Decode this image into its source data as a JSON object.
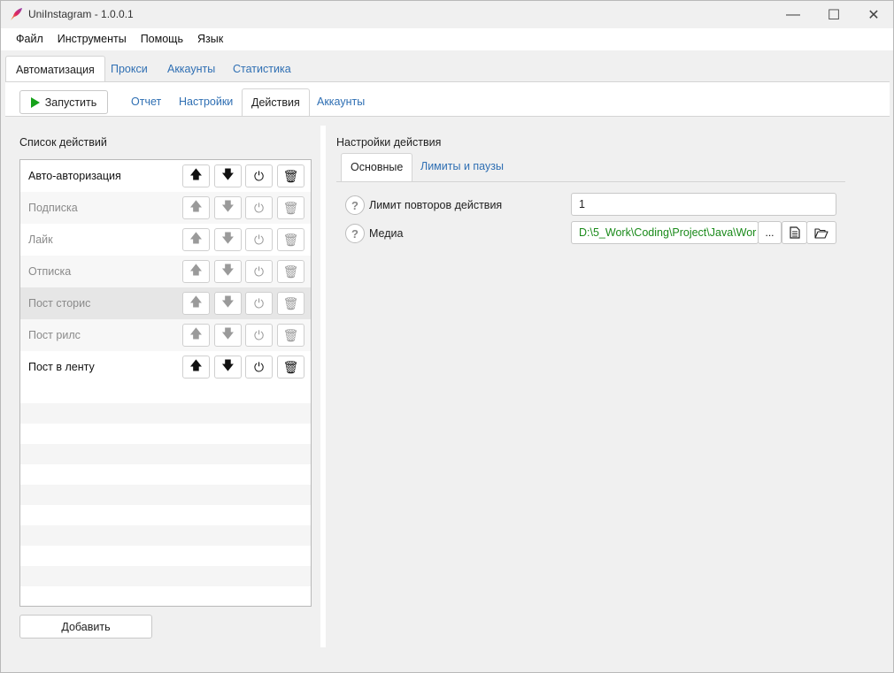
{
  "window": {
    "title": "UniInstagram - 1.0.0.1",
    "controls": {
      "minimize": "—",
      "maximize": "☐",
      "close": "✕"
    }
  },
  "menu": [
    "Файл",
    "Инструменты",
    "Помощь",
    "Язык"
  ],
  "main_tabs": [
    "Автоматизация",
    "Прокси",
    "Аккаунты",
    "Статистика"
  ],
  "toolbar": {
    "run_label": "Запустить"
  },
  "sub_tabs": [
    "Отчет",
    "Настройки",
    "Действия",
    "Аккаунты"
  ],
  "actions_panel": {
    "title": "Список действий",
    "items": [
      {
        "label": "Авто-авторизация",
        "enabled": true,
        "highlighted": false
      },
      {
        "label": "Подписка",
        "enabled": false,
        "highlighted": false
      },
      {
        "label": "Лайк",
        "enabled": false,
        "highlighted": false
      },
      {
        "label": "Отписка",
        "enabled": false,
        "highlighted": false
      },
      {
        "label": "Пост сторис",
        "enabled": false,
        "highlighted": true
      },
      {
        "label": "Пост рилс",
        "enabled": false,
        "highlighted": false
      },
      {
        "label": "Пост в ленту",
        "enabled": true,
        "highlighted": false
      }
    ],
    "add_label": "Добавить"
  },
  "settings_panel": {
    "title": "Настройки действия",
    "tabs": [
      "Основные",
      "Лимиты и паузы"
    ],
    "fields": {
      "repeat_limit": {
        "label": "Лимит повторов действия",
        "value": "1"
      },
      "media": {
        "label": "Медиа",
        "value": "D:\\5_Work\\Coding\\Project\\Java\\Wor",
        "browse_label": "..."
      }
    }
  },
  "icons": {
    "help": "?",
    "up": "🡅",
    "down": "🡇",
    "power": "⏻",
    "trash": "🗑"
  },
  "colors": {
    "accent_link": "#2f6fb3",
    "play": "#16a21a",
    "path_text": "#1a8a1a",
    "row_highlight": "#e6e6e6"
  }
}
